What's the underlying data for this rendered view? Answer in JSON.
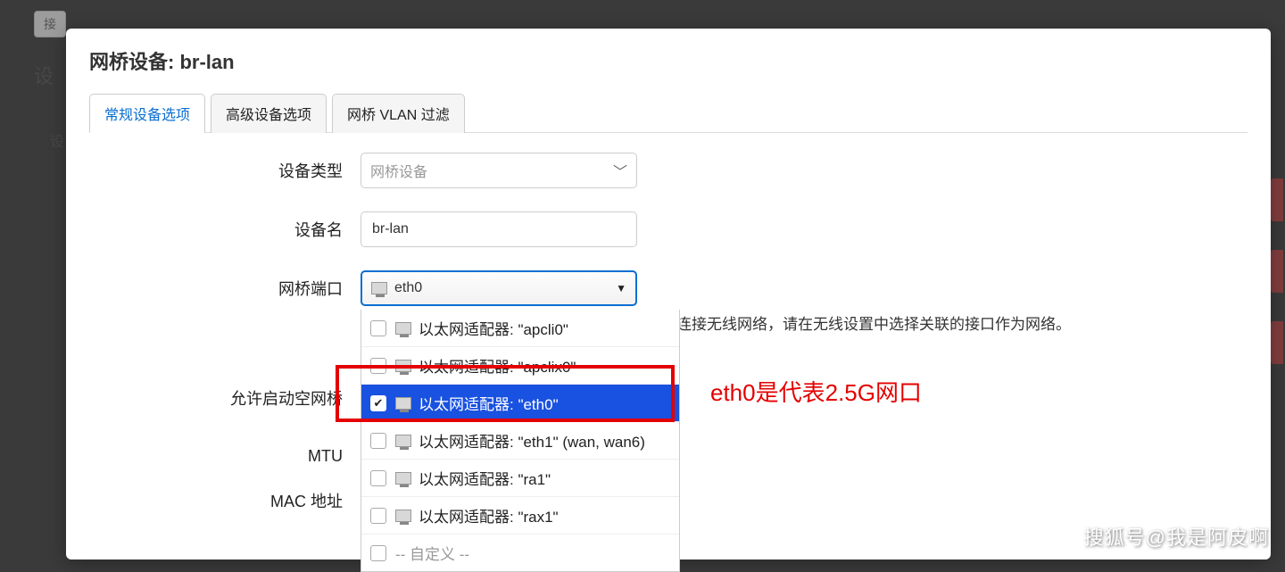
{
  "bg": {
    "tab_char": "接",
    "heading_char": "设",
    "subhead_char": "设"
  },
  "modal": {
    "title": "网桥设备: br-lan",
    "tabs": [
      "常规设备选项",
      "高级设备选项",
      "网桥 VLAN 过滤"
    ],
    "active_tab": 0
  },
  "form": {
    "device_type_label": "设备类型",
    "device_type_value": "网桥设备",
    "device_name_label": "设备名",
    "device_name_value": "br-lan",
    "bridge_ports_label": "网桥端口",
    "bridge_ports_selected": "eth0",
    "bridge_ports_help": "连接无线网络，请在无线设置中选择关联的接口作为网络。",
    "allow_empty_label": "允许启动空网桥",
    "mtu_label": "MTU",
    "mac_label": "MAC 地址"
  },
  "dropdown": {
    "items": [
      {
        "label": "以太网适配器: \"apcli0\"",
        "checked": false
      },
      {
        "label": "以太网适配器: \"apclix0\"",
        "checked": false
      },
      {
        "label": "以太网适配器: \"eth0\"",
        "checked": true
      },
      {
        "label": "以太网适配器: \"eth1\" (wan, wan6)",
        "checked": false
      },
      {
        "label": "以太网适配器: \"ra1\"",
        "checked": false
      },
      {
        "label": "以太网适配器: \"rax1\"",
        "checked": false
      }
    ],
    "custom_label": "-- 自定义 --"
  },
  "annotation": {
    "text": "eth0是代表2.5G网口"
  },
  "watermark": "搜狐号@我是阿皮啊"
}
